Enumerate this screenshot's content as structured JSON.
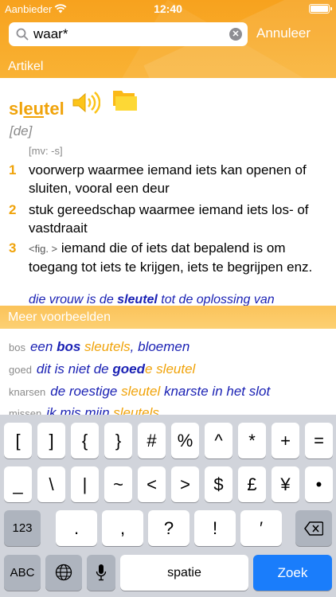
{
  "status": {
    "carrier": "Aanbieder",
    "time": "12:40"
  },
  "search": {
    "value": "waar*",
    "cancel_label": "Annuleer"
  },
  "sections": {
    "article": "Artikel",
    "more_examples": "Meer voorbeelden"
  },
  "entry": {
    "headword_pre": "sl",
    "headword_stress": "eu",
    "headword_post": "tel",
    "article": "[de]",
    "plural": "[mv: -s]",
    "definitions": [
      {
        "num": "1",
        "text": "voorwerp waarmee iemand iets kan openen of sluiten, vooral een deur"
      },
      {
        "num": "2",
        "text": "stuk gereedschap waarmee iemand iets los- of vastdraait"
      },
      {
        "num": "3",
        "fig": "<fig. >",
        "text": "iemand die of iets dat bepalend is om toegang tot iets te krijgen, iets te begrijpen enz."
      }
    ],
    "example_pre": "die vrouw is de ",
    "example_bold": "sleutel",
    "example_post": " tot de oplossing van"
  },
  "examples": [
    {
      "key": "bos",
      "pre": "een ",
      "bold": "bos",
      "mid": "",
      "hl": "sleutels",
      "post": ", bloemen"
    },
    {
      "key": "goed",
      "pre": "dit is niet de ",
      "bold": "goed",
      "mid": "",
      "hl": "e sleutel",
      "post": ""
    },
    {
      "key": "knarsen",
      "pre": "de roestige ",
      "bold": "",
      "mid": "",
      "hl": "sleutel",
      "post": " knarste in het slot"
    },
    {
      "key": "missen",
      "pre": "ik mis mijn ",
      "bold": "",
      "mid": "",
      "hl": "sleutels",
      "post": ""
    }
  ],
  "keyboard": {
    "row1": [
      "[",
      "]",
      "{",
      "}",
      "#",
      "%",
      "^",
      "*",
      "+",
      "="
    ],
    "row2": [
      "_",
      "\\",
      "|",
      "~",
      "<",
      ">",
      "$",
      "£",
      "¥",
      "•"
    ],
    "row3": [
      ".",
      ",",
      "?",
      "!",
      "′"
    ],
    "mode_label": "123",
    "abc_label": "ABC",
    "space_label": "spatie",
    "go_label": "Zoek"
  },
  "colors": {
    "accent": "#f0a30a",
    "example_blue": "#1b22b4",
    "go_blue": "#1a7dfb"
  }
}
